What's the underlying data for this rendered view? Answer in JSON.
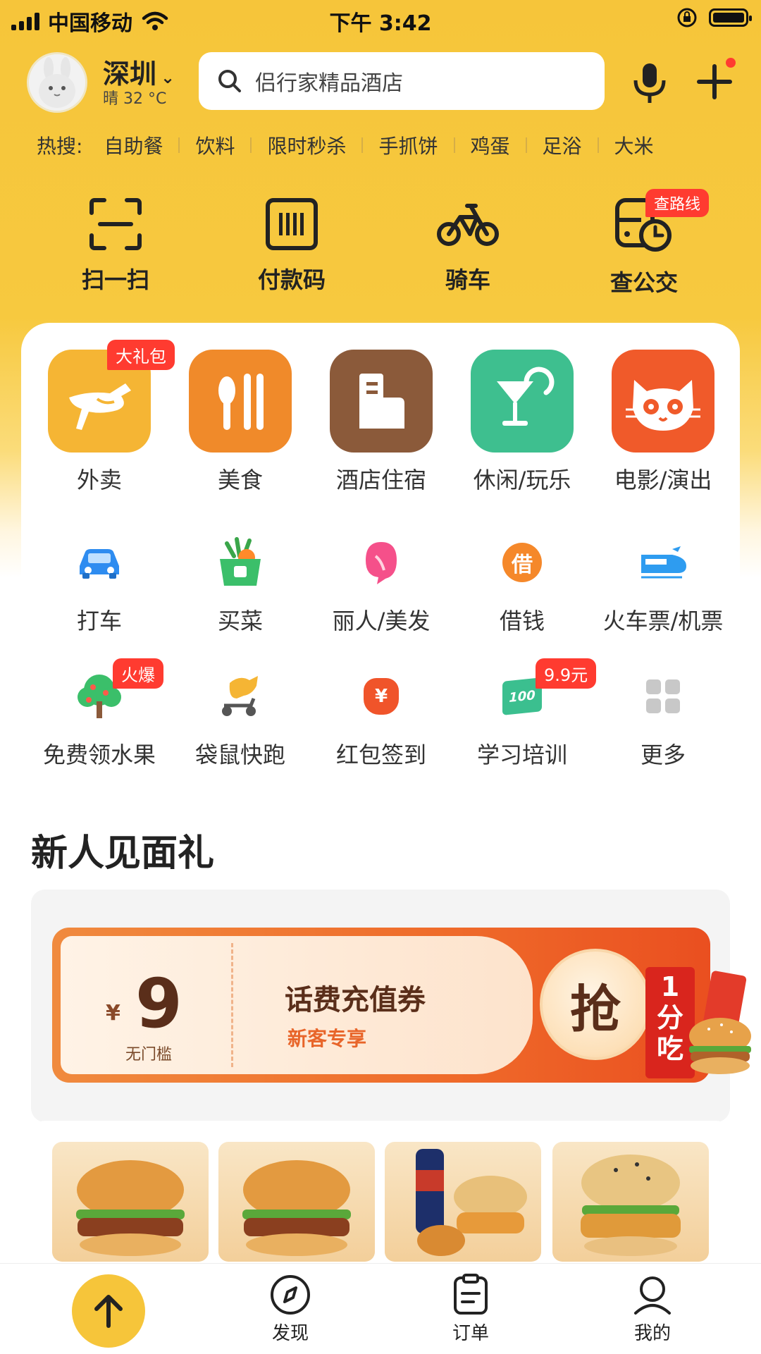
{
  "status": {
    "carrier": "中国移动",
    "time": "下午 3:42"
  },
  "header": {
    "city": "深圳",
    "weather": "晴 32 °C",
    "search_placeholder": "侣行家精品酒店"
  },
  "hot": {
    "label": "热搜:",
    "items": [
      "自助餐",
      "饮料",
      "限时秒杀",
      "手抓饼",
      "鸡蛋",
      "足浴",
      "大米"
    ]
  },
  "quick": [
    {
      "label": "扫一扫",
      "icon": "scan-icon"
    },
    {
      "label": "付款码",
      "icon": "barcode-icon"
    },
    {
      "label": "骑车",
      "icon": "bike-icon"
    },
    {
      "label": "查公交",
      "icon": "bus-icon",
      "badge": "查路线"
    }
  ],
  "grid_main": [
    {
      "label": "外卖",
      "icon": "kangaroo-icon",
      "color": "#f5b534",
      "badge": "大礼包"
    },
    {
      "label": "美食",
      "icon": "utensils-icon",
      "color": "#f08a2a"
    },
    {
      "label": "酒店住宿",
      "icon": "hotel-icon",
      "color": "#8b5a3a"
    },
    {
      "label": "休闲/玩乐",
      "icon": "cocktail-icon",
      "color": "#3ebf8f"
    },
    {
      "label": "电影/演出",
      "icon": "cat-icon",
      "color": "#f05a2a"
    }
  ],
  "grid_row2": [
    {
      "label": "打车",
      "icon": "car-icon"
    },
    {
      "label": "买菜",
      "icon": "vegetable-basket-icon"
    },
    {
      "label": "丽人/美发",
      "icon": "hair-icon"
    },
    {
      "label": "借钱",
      "icon": "borrow-icon",
      "glyph": "借"
    },
    {
      "label": "火车票/机票",
      "icon": "train-icon"
    }
  ],
  "grid_row3": [
    {
      "label": "免费领水果",
      "icon": "tree-icon",
      "badge": "火爆"
    },
    {
      "label": "袋鼠快跑",
      "icon": "kangaroo-scooter-icon"
    },
    {
      "label": "红包签到",
      "icon": "money-bag-icon",
      "glyph": "¥"
    },
    {
      "label": "学习培训",
      "icon": "study-icon",
      "badge": "9.9元",
      "glyph": "100"
    },
    {
      "label": "更多",
      "icon": "more-grid-icon"
    }
  ],
  "section": {
    "title": "新人见面礼"
  },
  "coupon": {
    "currency": "¥",
    "amount": "9",
    "condition": "无门槛",
    "title": "话费充值券",
    "subtitle": "新客专享",
    "grab": "抢",
    "promo": "1分吃"
  },
  "tabbar": [
    {
      "label": "发现",
      "icon": "compass-icon"
    },
    {
      "label": "订单",
      "icon": "order-icon"
    },
    {
      "label": "我的",
      "icon": "user-icon"
    }
  ],
  "colors": {
    "brand_yellow": "#f6c53a",
    "badge_red": "#ff3b30",
    "coupon_orange": "#ef6b2a"
  }
}
